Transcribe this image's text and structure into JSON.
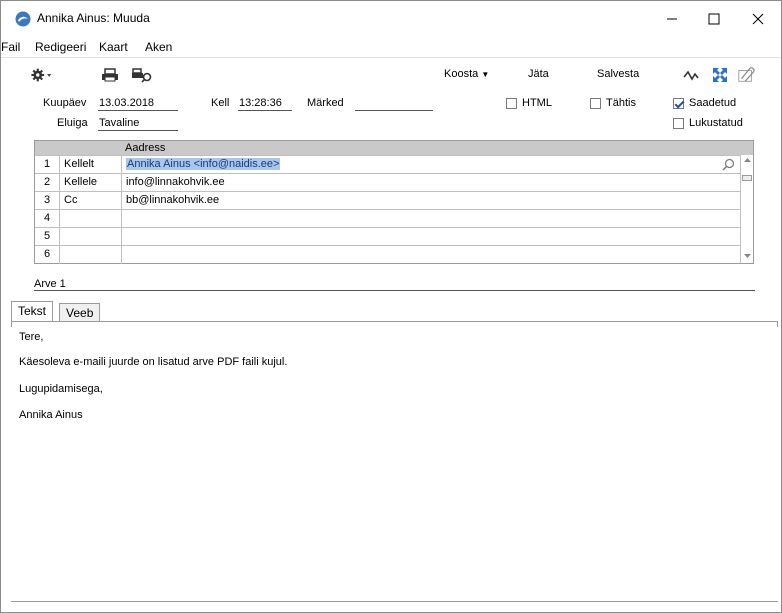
{
  "window": {
    "title": "Annika Ainus: Muuda",
    "minimize": "—",
    "maximize": "☐",
    "close": "✕"
  },
  "menu": [
    "Fail",
    "Redigeeri",
    "Kaart",
    "Aken"
  ],
  "toolbar": {
    "koosta": "Koosta",
    "jata": "Jäta",
    "salvesta": "Salvesta"
  },
  "header": {
    "kuupaev_label": "Kuupäev",
    "kuupaev_value": "13.03.2018",
    "kell_label": "Kell",
    "kell_value": "13:28:36",
    "marked_label": "Märked",
    "marked_value": "",
    "eluiga_label": "Eluiga",
    "eluiga_value": "Tavaline",
    "html_label": "HTML",
    "tahtis_label": "Tähtis",
    "saadetud_label": "Saadetud",
    "lukustatud_label": "Lukustatud",
    "html_checked": false,
    "tahtis_checked": false,
    "saadetud_checked": true,
    "lukustatud_checked": false
  },
  "grid": {
    "column_header": "Aadress",
    "rows": [
      {
        "num": "1",
        "type": "Kellelt",
        "address": "Annika Ainus <info@naidis.ee>"
      },
      {
        "num": "2",
        "type": "Kellele",
        "address": "info@linnakohvik.ee"
      },
      {
        "num": "3",
        "type": "Cc",
        "address": "bb@linnakohvik.ee"
      },
      {
        "num": "4",
        "type": "",
        "address": ""
      },
      {
        "num": "5",
        "type": "",
        "address": ""
      },
      {
        "num": "6",
        "type": "",
        "address": ""
      }
    ]
  },
  "attachment": "Arve 1",
  "tabs": {
    "tekst": "Tekst",
    "veeb": "Veeb"
  },
  "body": {
    "line1": "Tere,",
    "line2": "Käesoleva e-maili juurde on lisatud arve PDF faili kujul.",
    "line3": "Lugupidamisega,",
    "line4": "Annika Ainus"
  },
  "colors": {
    "selection": "#a8c7ec",
    "grid_header": "#c9c9c9",
    "accent_blue": "#2b6fd1"
  }
}
